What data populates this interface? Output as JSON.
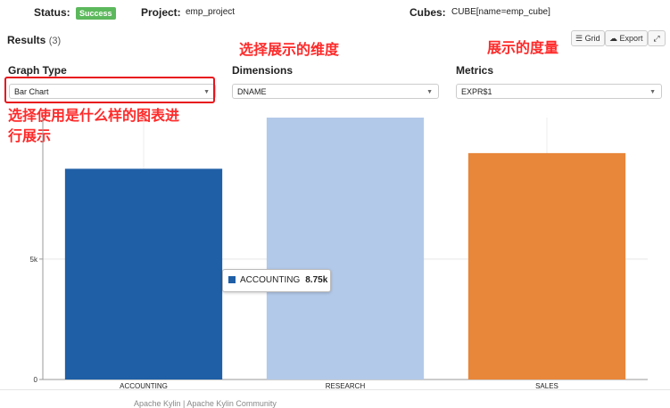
{
  "status": {
    "label": "Status:",
    "value": "Success"
  },
  "project": {
    "label": "Project:",
    "value": "emp_project"
  },
  "cubes": {
    "label": "Cubes:",
    "value": "CUBE[name=emp_cube]"
  },
  "results": {
    "title": "Results",
    "count": "(3)"
  },
  "toolbar": {
    "grid_label": "Grid",
    "export_label": "Export",
    "grid_icon": "list-icon",
    "export_icon": "cloud-icon",
    "expand_icon": "expand-icon"
  },
  "annotations": {
    "dimension_note": "选择展示的维度",
    "metric_note": "展示的度量",
    "graph_type_note_line1": "选择使用是什么样的图表进",
    "graph_type_note_line2": "行展示"
  },
  "graph_type": {
    "label": "Graph Type",
    "selected": "Bar Chart"
  },
  "dimensions": {
    "label": "Dimensions",
    "selected": "DNAME"
  },
  "metrics": {
    "label": "Metrics",
    "selected": "EXPR$1"
  },
  "tooltip": {
    "category": "ACCOUNTING",
    "value": "8.75k"
  },
  "chart_data": {
    "type": "bar",
    "categories": [
      "ACCOUNTING",
      "RESEARCH",
      "SALES"
    ],
    "values": [
      8750,
      10875,
      9400
    ],
    "colors": [
      "#1f5fa6",
      "#b3c9e9",
      "#e8863a"
    ],
    "ylim": [
      0,
      10875
    ],
    "yticks": [
      0,
      5000
    ],
    "ytick_labels": [
      "0",
      "5k"
    ],
    "grid": true
  },
  "footer": {
    "text": "Apache Kylin | Apache Kylin Community"
  }
}
